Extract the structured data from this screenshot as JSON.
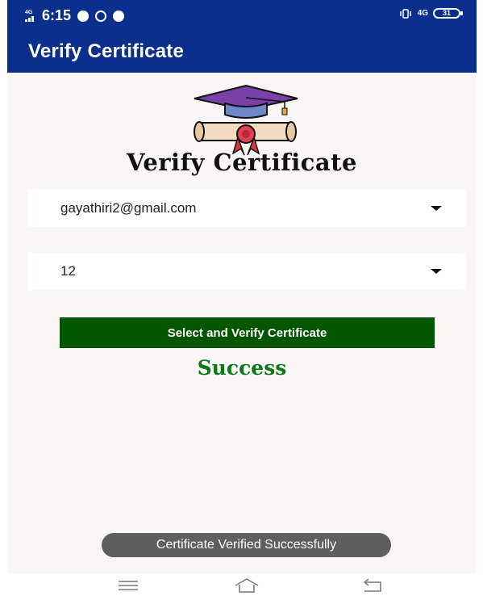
{
  "status_bar": {
    "network": "4G",
    "time": "6:15",
    "right_network": "4G",
    "battery": "31"
  },
  "app_bar": {
    "title": "Verify Certificate"
  },
  "page": {
    "heading": "Verify Certificate",
    "email_dropdown": {
      "value": "gayathiri2@gmail.com"
    },
    "number_dropdown": {
      "value": "12"
    },
    "verify_button_label": "Select and Verify Certificate",
    "result_text": "Success"
  },
  "toast": {
    "message": "Certificate Verified Successfully"
  },
  "nav_bar": {
    "icons": [
      "menu-icon",
      "home-icon",
      "back-icon"
    ]
  },
  "colors": {
    "app_bar": "#0a2f8c",
    "button": "#025600",
    "success": "#0a7a16",
    "background": "#fbf6f6"
  }
}
